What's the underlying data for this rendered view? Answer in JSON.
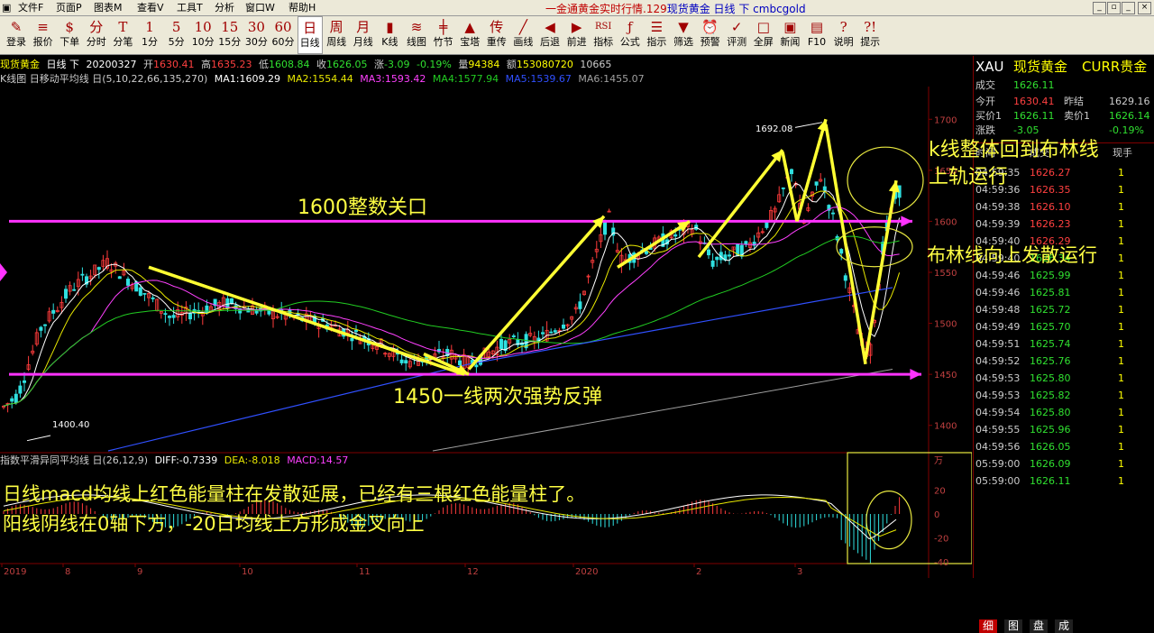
{
  "menu": {
    "items": [
      "文件F",
      "页面P",
      "图表M",
      "查看V",
      "工具T",
      "分析",
      "窗口W",
      "帮助H"
    ],
    "title_main": "一金通黄金实时行情.129",
    "title_blue": "现货黄金 日线 下 cmbcgold"
  },
  "toolbar": [
    {
      "icon": "✎",
      "label": "登录"
    },
    {
      "icon": "≡",
      "label": "报价"
    },
    {
      "icon": "$",
      "label": "下单"
    },
    {
      "icon": "分",
      "label": "分时"
    },
    {
      "icon": "T",
      "label": "分笔"
    },
    {
      "icon": "1",
      "label": "1分"
    },
    {
      "icon": "5",
      "label": "5分"
    },
    {
      "icon": "10",
      "label": "10分"
    },
    {
      "icon": "15",
      "label": "15分"
    },
    {
      "icon": "30",
      "label": "30分"
    },
    {
      "icon": "60",
      "label": "60分"
    },
    {
      "icon": "日",
      "label": "日线"
    },
    {
      "icon": "周",
      "label": "周线"
    },
    {
      "icon": "月",
      "label": "月线"
    },
    {
      "icon": "▮",
      "label": "K线"
    },
    {
      "icon": "≋",
      "label": "线图"
    },
    {
      "icon": "╪",
      "label": "竹节"
    },
    {
      "icon": "▲",
      "label": "宝塔"
    },
    {
      "icon": "传",
      "label": "重传"
    },
    {
      "icon": "╱",
      "label": "画线"
    },
    {
      "icon": "◀",
      "label": "后退"
    },
    {
      "icon": "▶",
      "label": "前进"
    },
    {
      "icon": "RSI",
      "label": "指标"
    },
    {
      "icon": "ƒ",
      "label": "公式"
    },
    {
      "icon": "☰",
      "label": "指示"
    },
    {
      "icon": "▼",
      "label": "筛选"
    },
    {
      "icon": "⏰",
      "label": "预警"
    },
    {
      "icon": "✓",
      "label": "评测"
    },
    {
      "icon": "□",
      "label": "全屏"
    },
    {
      "icon": "▣",
      "label": "新闻"
    },
    {
      "icon": "▤",
      "label": "F10"
    },
    {
      "icon": "?",
      "label": "说明"
    },
    {
      "icon": "?!",
      "label": "提示"
    }
  ],
  "info1": {
    "name": "现货黄金",
    "period": "日线 下",
    "date": "20200327",
    "open_label": "开",
    "open": "1630.41",
    "high_label": "高",
    "high": "1635.23",
    "low_label": "低",
    "low": "1608.84",
    "close_label": "收",
    "close": "1626.05",
    "change_label": "涨",
    "change": "-3.09",
    "pct": "-0.19%",
    "vol_label": "量",
    "vol": "94384",
    "amt_label": "额",
    "amt": "153080720",
    "extra": "10665"
  },
  "info2": {
    "prefix": "K线图 日移动平均线 日(5,10,22,66,135,270)",
    "ma1": "MA1:1609.29",
    "ma2": "MA2:1554.44",
    "ma3": "MA3:1593.42",
    "ma4": "MA4:1577.94",
    "ma5": "MA5:1539.67",
    "ma6": "MA6:1455.07"
  },
  "macd_info": {
    "prefix": "指数平滑异同平均线 日(26,12,9)",
    "diff": "DIFF:-0.7339",
    "dea": "DEA:-8.018",
    "macd": "MACD:14.57"
  },
  "price_axis": [
    "1700",
    "1650",
    "1600",
    "1550",
    "1500",
    "1450",
    "1400"
  ],
  "macd_axis": [
    "万",
    "20",
    "0",
    "-20",
    "-40"
  ],
  "x_axis": [
    "2019",
    "8",
    "9",
    "10",
    "11",
    "12",
    "2020",
    "2",
    "3"
  ],
  "chart_labels": {
    "high": "1692.08",
    "low": "1400.40"
  },
  "annotations": {
    "a1": "1600整数关口",
    "a2": "1450一线两次强势反弹",
    "a3_line1": "k线整体回到布林线",
    "a3_line2": "上轨运行",
    "a4": "布林线向上发散运行",
    "a5_line1": "日线macd均线上红色能量柱在发散延展，已经有三根红色能量柱了。",
    "a5_line2": "阳线阴线在0轴下方，-20日均线上方形成金叉向上"
  },
  "quote": {
    "code": "XAU",
    "name": "现货黄金",
    "market": "CURR贵金",
    "last_label": "成交",
    "last": "1626.11",
    "open_label": "今开",
    "open": "1630.41",
    "prev_label": "昨结",
    "prev": "1629.16",
    "bid_label": "买价1",
    "bid": "1626.11",
    "ask_label": "卖价1",
    "ask": "1626.14",
    "chg_label": "涨跌",
    "chg": "-3.05",
    "pct": "-0.19%",
    "tick_headers": [
      "时间",
      "成交",
      "现手"
    ],
    "ticks": [
      [
        "04:59:35",
        "1626.27",
        "1"
      ],
      [
        "04:59:36",
        "1626.35",
        "1"
      ],
      [
        "04:59:38",
        "1626.10",
        "1"
      ],
      [
        "04:59:39",
        "1626.23",
        "1"
      ],
      [
        "04:59:40",
        "1626.29",
        "1"
      ],
      [
        "04:59:40",
        "1626.34",
        "1"
      ],
      [
        "04:59:46",
        "1625.99",
        "1"
      ],
      [
        "04:59:46",
        "1625.81",
        "1"
      ],
      [
        "04:59:48",
        "1625.72",
        "1"
      ],
      [
        "04:59:49",
        "1625.70",
        "1"
      ],
      [
        "04:59:51",
        "1625.74",
        "1"
      ],
      [
        "04:59:52",
        "1625.76",
        "1"
      ],
      [
        "04:59:53",
        "1625.80",
        "1"
      ],
      [
        "04:59:53",
        "1625.82",
        "1"
      ],
      [
        "04:59:54",
        "1625.80",
        "1"
      ],
      [
        "04:59:55",
        "1625.96",
        "1"
      ],
      [
        "04:59:56",
        "1626.05",
        "1"
      ],
      [
        "05:59:00",
        "1626.09",
        "1"
      ],
      [
        "05:59:00",
        "1626.11",
        "1"
      ]
    ],
    "bottom_tabs": [
      "细",
      "图",
      "盘",
      "成"
    ]
  },
  "colors": {
    "up": "#ff3b3b",
    "down": "#2fe0e0",
    "magenta": "#ff33ff",
    "yellow": "#ffff33",
    "ma_white": "#ffffff",
    "ma_yellow": "#e8e800",
    "ma_magenta": "#ff40ff",
    "ma_green": "#22cc22",
    "ma_blue": "#3050ff",
    "ma_gray": "#a0a0a0"
  }
}
